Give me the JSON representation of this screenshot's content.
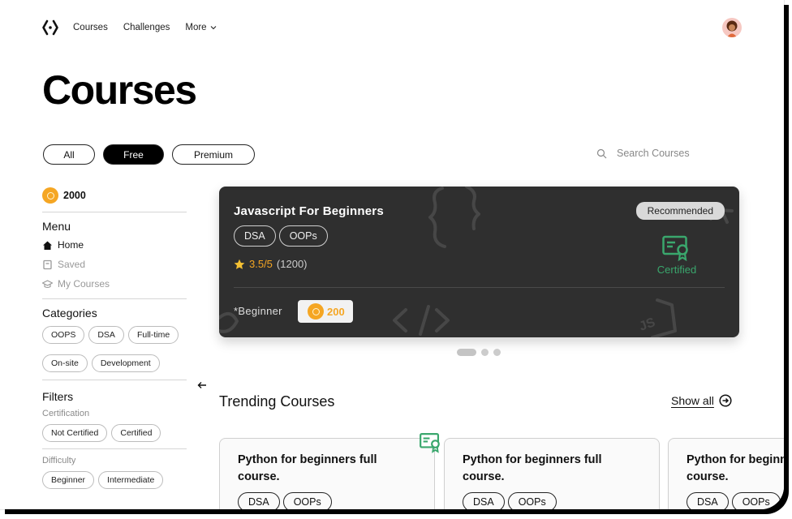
{
  "nav": {
    "links": [
      "Courses",
      "Challenges"
    ],
    "more_label": "More"
  },
  "page_title": "Courses",
  "filters": [
    "All",
    "Free",
    "Premium"
  ],
  "active_filter": "Free",
  "search": {
    "placeholder": "Search Courses"
  },
  "sidebar": {
    "balance": "2000",
    "menu_title": "Menu",
    "menu": [
      {
        "label": "Home",
        "icon": "home-icon",
        "active": true
      },
      {
        "label": "Saved",
        "icon": "bookmark-icon",
        "active": false
      },
      {
        "label": "My Courses",
        "icon": "graduation-cap-icon",
        "active": false
      }
    ],
    "categories_title": "Categories",
    "categories": [
      "OOPS",
      "DSA",
      "Full-time",
      "On-site",
      "Development"
    ],
    "filters_title": "Filters",
    "certification_title": "Certification",
    "certification": [
      "Not Certified",
      "Certified"
    ],
    "difficulty_title": "Difficulty",
    "difficulty": [
      "Beginner",
      "Intermediate"
    ]
  },
  "hero": {
    "title": "Javascript For Beginners",
    "tags": [
      "DSA",
      "OOPs"
    ],
    "rating_score": "3.5/5",
    "rating_count": "(1200)",
    "level": "*Beginner",
    "price": "200",
    "badge": "Recommended",
    "cert_label": "Certified"
  },
  "carousel": {
    "count": 3,
    "active": 0
  },
  "trending": {
    "title": "Trending Courses",
    "show_all": "Show all",
    "cards": [
      {
        "title": "Python for beginners full course.",
        "tags": [
          "DSA",
          "OOPs"
        ],
        "certified": true
      },
      {
        "title": "Python for beginners full course.",
        "tags": [
          "DSA",
          "OOPs"
        ],
        "certified": false
      },
      {
        "title": "Python for beginners full course.",
        "tags": [
          "DSA",
          "OOPs"
        ],
        "certified": false
      }
    ]
  },
  "colors": {
    "accent": "#f5a623",
    "certified": "#3aa76d",
    "hero_bg": "#2f2f2f"
  }
}
